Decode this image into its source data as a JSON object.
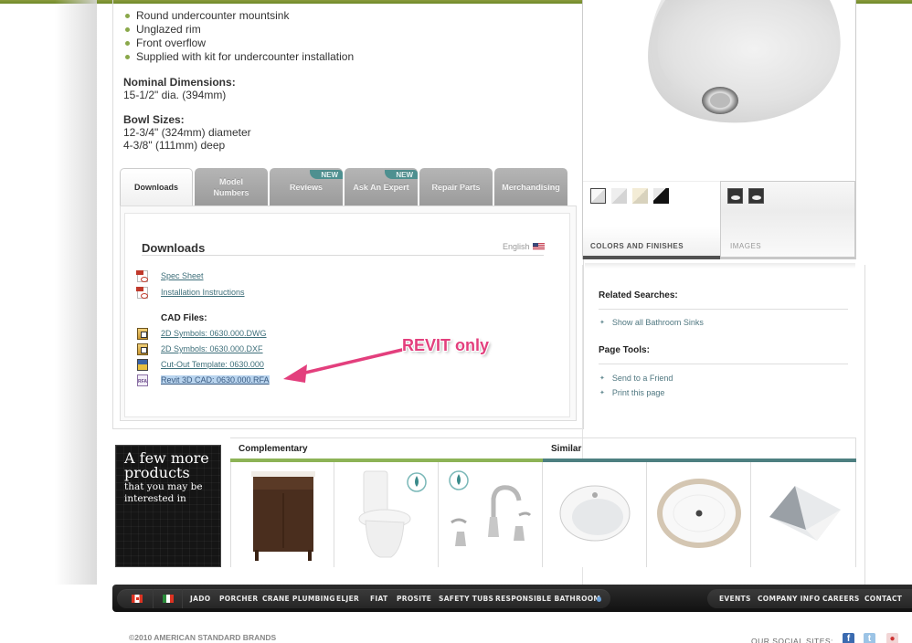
{
  "product": {
    "features": [
      "Round undercounter mountsink",
      "Unglazed rim",
      "Front overflow",
      "Supplied with kit for undercounter installation"
    ],
    "nominal_dimensions_label": "Nominal Dimensions:",
    "nominal_dimensions": "15-1/2\" dia. (394mm)",
    "bowl_sizes_label": "Bowl Sizes:",
    "bowl_sizes": [
      "12-3/4\" (324mm) diameter",
      "4-3/8\" (111mm) deep"
    ]
  },
  "tabs": [
    {
      "label": "Downloads",
      "active": true
    },
    {
      "label": "Model Numbers"
    },
    {
      "label": "Reviews",
      "badge": "NEW"
    },
    {
      "label": "Ask An Expert",
      "badge": "NEW"
    },
    {
      "label": "Repair Parts"
    },
    {
      "label": "Merchandising"
    }
  ],
  "downloads": {
    "title": "Downloads",
    "language": "English",
    "documents": [
      {
        "label": "Spec Sheet",
        "icon": "pdf-icon"
      },
      {
        "label": "Installation Instructions",
        "icon": "pdf-icon"
      }
    ],
    "cad_label": "CAD Files:",
    "cad_files": [
      {
        "label": "2D Symbols: 0630.000.DWG",
        "icon": "dwg-file-icon"
      },
      {
        "label": "2D Symbols: 0630.000.DXF",
        "icon": "dxf-file-icon"
      },
      {
        "label": "Cut-Out Template: 0630.000",
        "icon": "template-file-icon"
      },
      {
        "label": "Revit 3D CAD: 0630.000.RFA",
        "icon": "rfa-file-icon",
        "selected": true
      }
    ]
  },
  "annotation": {
    "text": "REVIT only",
    "color": "#e33f7d"
  },
  "gallery": {
    "colors_label": "COLORS AND FINISHES",
    "images_label": "IMAGES",
    "swatches": [
      "#ffffff",
      "#f4f4f4",
      "#f3ecd6",
      "#111111"
    ]
  },
  "sidebar": {
    "related_title": "Related Searches:",
    "related_links": [
      "Show all Bathroom Sinks"
    ],
    "tools_title": "Page Tools:",
    "tools_links": [
      "Send to a Friend",
      "Print this page"
    ]
  },
  "more_products": {
    "headline": "A few more products",
    "subline": "that you may be interested in",
    "complementary_label": "Complementary",
    "similar_label": "Similar",
    "complementary": [
      "vanity",
      "toilet",
      "faucet"
    ],
    "similar": [
      "drop-in sink",
      "oval undercounter sink",
      "rectangular sink"
    ],
    "complementary_color": "#8db356",
    "similar_color": "#4d7f80"
  },
  "footer": {
    "brands": [
      "JADO",
      "PORCHER",
      "CRANE PLUMBING",
      "ELJER",
      "FIAT",
      "PROSITE",
      "SAFETY TUBS",
      "RESPONSIBLE BATHROOM"
    ],
    "links": [
      "EVENTS",
      "COMPANY INFO",
      "CAREERS",
      "CONTACT"
    ],
    "copyright": "©2010 AMERICAN STANDARD BRANDS",
    "social_label": "OUR SOCIAL SITES:"
  }
}
